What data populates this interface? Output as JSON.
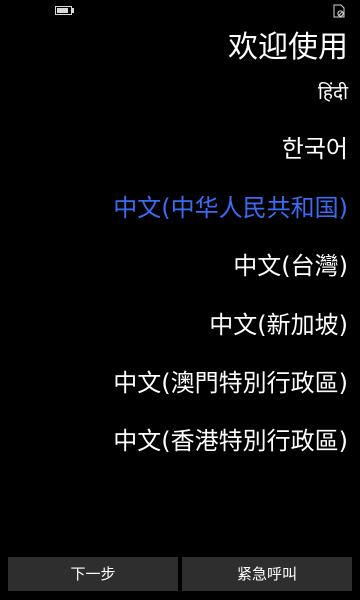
{
  "status_bar": {
    "battery_level": 0.85,
    "icons": [
      "battery-icon",
      "no-sim-icon"
    ]
  },
  "header": {
    "title": "欢迎使用",
    "hindi_label": "हिंदी"
  },
  "languages": [
    {
      "label": "한국어",
      "selected": false
    },
    {
      "label": "中文(中华人民共和国)",
      "selected": true
    },
    {
      "label": "中文(台灣)",
      "selected": false
    },
    {
      "label": "中文(新加坡)",
      "selected": false
    },
    {
      "label": "中文(澳門特別行政區)",
      "selected": false
    },
    {
      "label": "中文(香港特別行政區)",
      "selected": false
    }
  ],
  "bottom_bar": {
    "next_label": "下一步",
    "emergency_label": "紧急呼叫"
  },
  "colors": {
    "background": "#000000",
    "text": "#ffffff",
    "accent": "#3a6cf4",
    "button": "#2e2e2e"
  }
}
